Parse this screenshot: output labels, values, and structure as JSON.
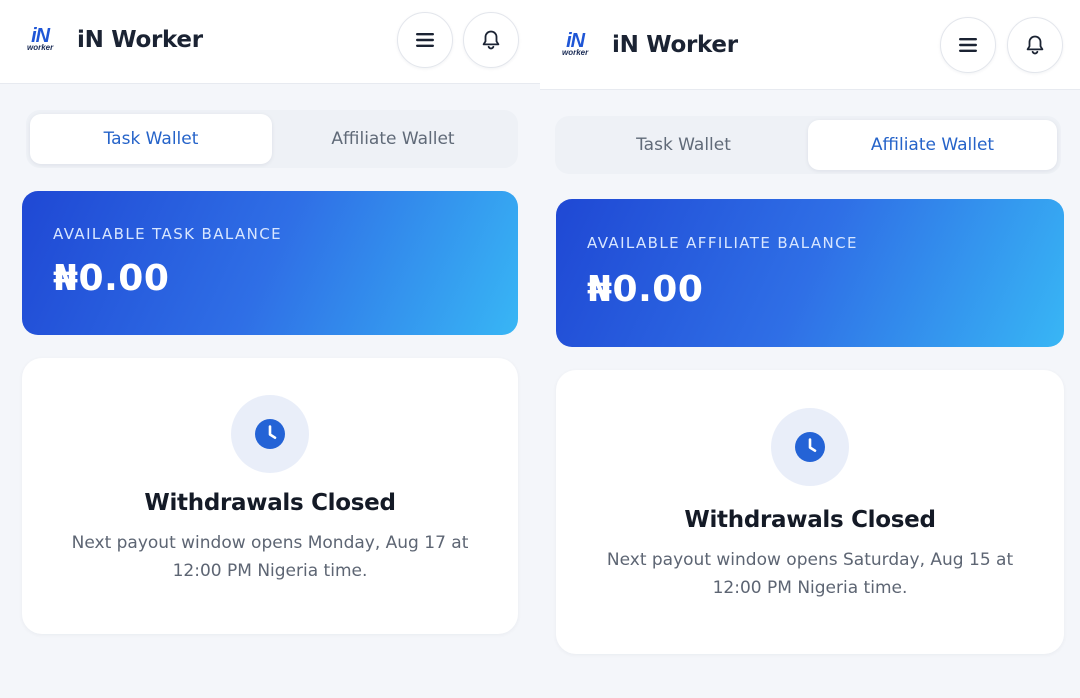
{
  "screens": [
    {
      "header": {
        "logo_main": "iN",
        "logo_sub": "worker",
        "title": "iN Worker",
        "menu_icon": "hamburger-menu-icon",
        "bell_icon": "bell-icon"
      },
      "tabs": [
        {
          "label": "Task Wallet",
          "active": true
        },
        {
          "label": "Affiliate Wallet",
          "active": false
        }
      ],
      "balance": {
        "label": "AVAILABLE TASK BALANCE",
        "value": "₦0.00"
      },
      "status": {
        "icon": "clock-icon",
        "title": "Withdrawals Closed",
        "description": "Next payout window opens Monday, Aug 17 at 12:00 PM Nigeria time."
      }
    },
    {
      "header": {
        "logo_main": "iN",
        "logo_sub": "worker",
        "title": "iN Worker",
        "menu_icon": "hamburger-menu-icon",
        "bell_icon": "bell-icon"
      },
      "tabs": [
        {
          "label": "Task Wallet",
          "active": false
        },
        {
          "label": "Affiliate Wallet",
          "active": true
        }
      ],
      "balance": {
        "label": "AVAILABLE AFFILIATE BALANCE",
        "value": "₦0.00"
      },
      "status": {
        "icon": "clock-icon",
        "title": "Withdrawals Closed",
        "description": "Next payout window opens Saturday, Aug 15 at 12:00 PM Nigeria time."
      }
    }
  ],
  "colors": {
    "accent": "#2563c9",
    "gradient_start": "#1f48d4",
    "gradient_end": "#38b6f5",
    "background": "#f4f6fa"
  }
}
